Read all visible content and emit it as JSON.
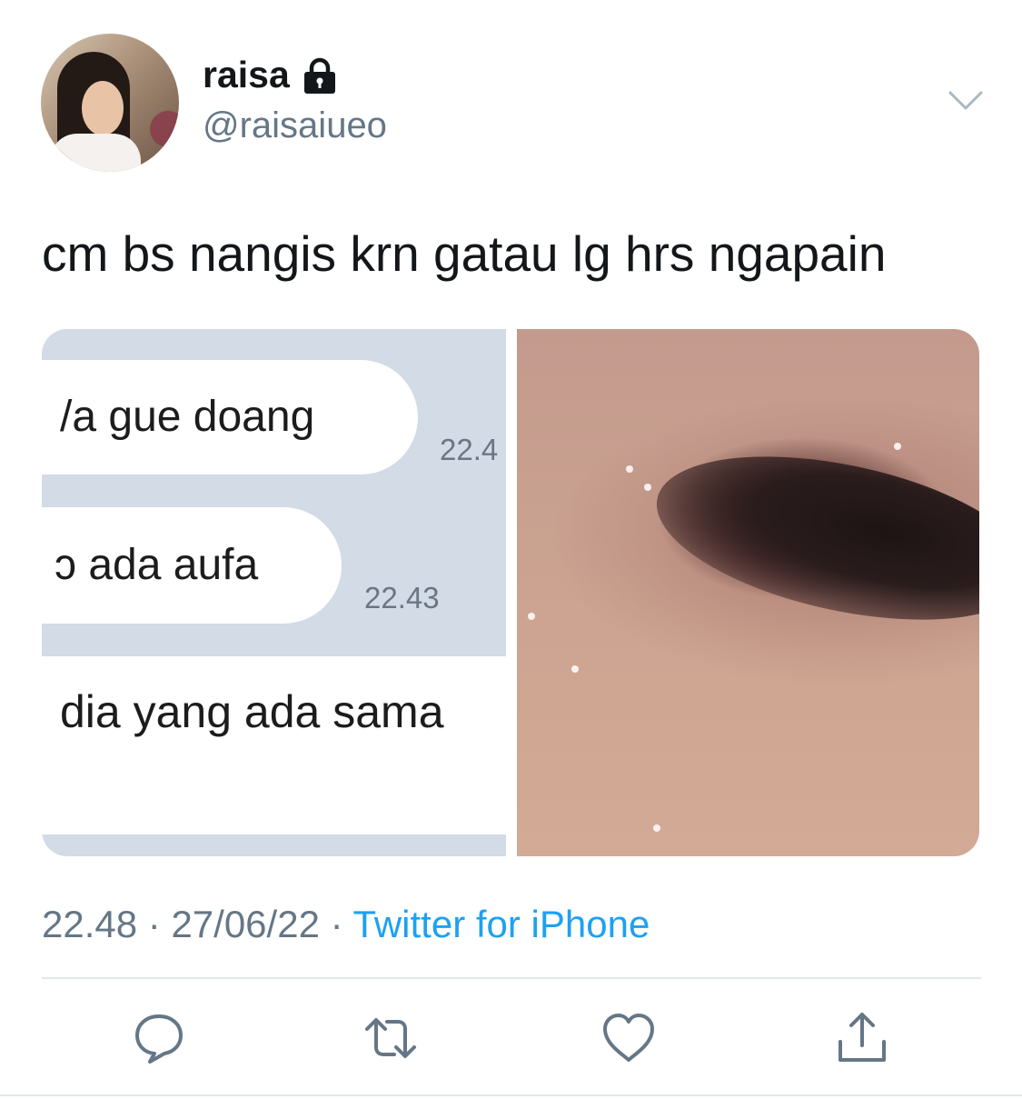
{
  "user": {
    "display_name": "raisa",
    "handle": "@raisaiueo",
    "protected": true
  },
  "tweet": {
    "text": "cm bs nangis krn gatau lg hrs ngapain"
  },
  "media": {
    "chat_messages": [
      {
        "text": "/a gue doang",
        "time": "22.4"
      },
      {
        "text": "ɔ ada aufa",
        "time": "22.43"
      },
      {
        "text": "dia yang ada sama",
        "time": ""
      }
    ]
  },
  "meta": {
    "time": "22.48",
    "separator": " · ",
    "date": "27/06/22",
    "source": "Twitter for iPhone"
  },
  "icons": {
    "reply": "reply-icon",
    "retweet": "retweet-icon",
    "like": "like-icon",
    "share": "share-icon",
    "more": "chevron-down-icon"
  },
  "colors": {
    "text": "#14171a",
    "secondary": "#657786",
    "accent": "#1da1f2",
    "divider": "#e1e8ed"
  }
}
